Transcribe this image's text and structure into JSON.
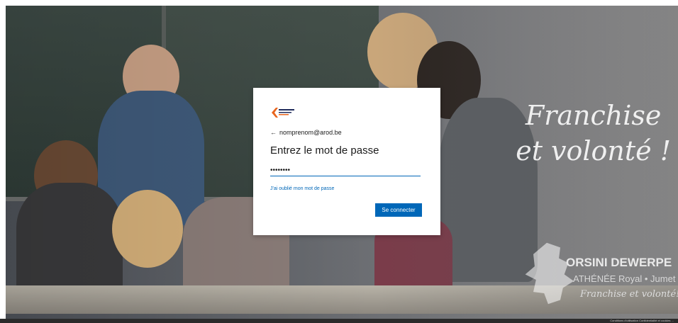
{
  "login": {
    "back_icon": "arrow-left-icon",
    "account": "nomprenom@arod.be",
    "title": "Entrez le mot de passe",
    "password_value": "••••••••",
    "forgot_link": "J'ai oublié mon mot de passe",
    "submit_label": "Se connecter"
  },
  "background": {
    "slogan_line1": "Franchise",
    "slogan_line2": "et volonté !",
    "brand_name": "ORSINI DEWERPE",
    "brand_sub": "ATHÉNÉE Royal • Jumet",
    "brand_motto": "Franchise et volonté!"
  },
  "footer": {
    "links": "Conditions d'utilisation  Confidentialité et cookies  ..."
  },
  "colors": {
    "accent": "#0067b8",
    "logo_orange": "#e8651e",
    "logo_navy": "#1f2b5b"
  }
}
